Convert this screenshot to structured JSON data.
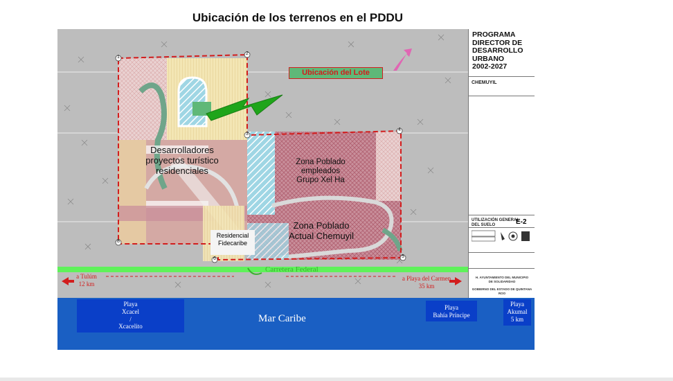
{
  "title": "Ubicación de los terrenos en el PDDU",
  "map": {
    "lote_label": "Ubicación del Lote",
    "zones": {
      "desarrolladores": "Desarrolladores\nproyectos turístico\nresidenciales",
      "zona_xelha": "Zona Poblado\nempleados\nGrupo Xel Ha",
      "zona_chemuyil": "Zona Poblado\nActual Chemuyil",
      "residencial": "Residencial\nFidecaribe"
    },
    "road_label": "Carretera Federal",
    "directions": {
      "left": "a Tulúm\n12 km",
      "right": "a Playa del Carmen\n35 km"
    },
    "markers": [
      "1",
      "2",
      "3",
      "4",
      "5",
      "6",
      "8"
    ]
  },
  "title_block": {
    "program": "PROGRAMA\nDIRECTOR DE\nDESARROLLO\nURBANO\n2002-2027",
    "locality": "CHEMUYIL",
    "plan_name": "UTILIZACIÓN GENERAL\nDEL SUELO",
    "plan_code": "E-2",
    "ayuntamiento": "H. AYUNTAMIENTO DEL MUNICIPIO\nDE SOLIDARIDAD",
    "gobierno": "GOBIERNO DEL ESTADO DE QUINTANA ROO"
  },
  "sea": {
    "label": "Mar Caribe",
    "beaches": [
      "Playa\nXcacel\n/\nXcacelito",
      "Playa\nBahía Príncipe",
      "Playa\nAkumal\n5 km"
    ]
  },
  "colors": {
    "boundary": "#d21d1d",
    "arrow": "#1fa51a",
    "road": "#5ff25a",
    "sea": "#1a5fc3",
    "beach_box": "#0a3fc8"
  }
}
